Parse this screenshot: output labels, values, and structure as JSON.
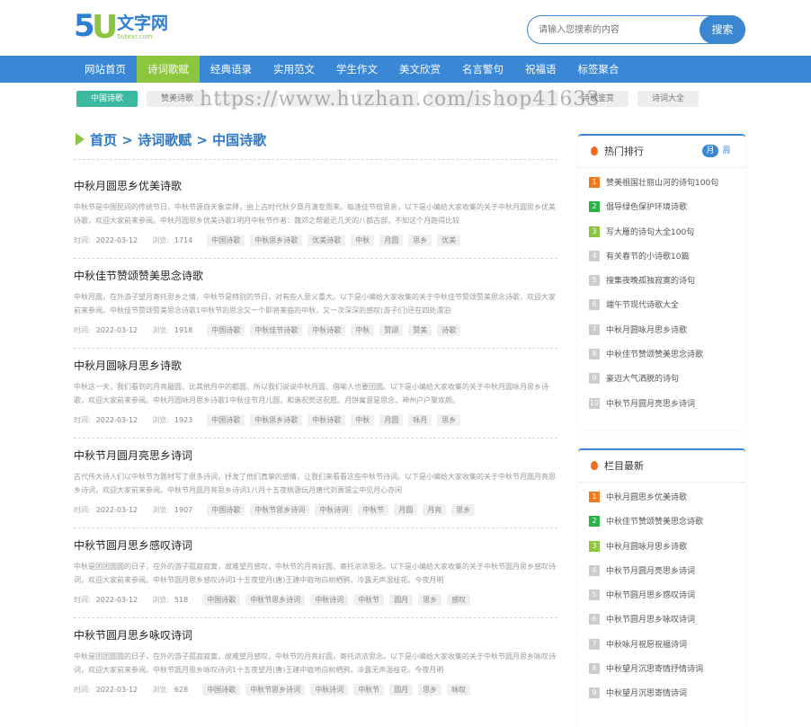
{
  "logo": {
    "five": "5",
    "u": "U",
    "cn": "文字网",
    "en": "5utexr.com"
  },
  "search": {
    "placeholder": "请输入您搜索的内容",
    "button": "搜索"
  },
  "nav": {
    "items": [
      "网站首页",
      "诗词歌赋",
      "经典语录",
      "实用范文",
      "学生作文",
      "美文欣赏",
      "名言警句",
      "祝福语",
      "标签聚合"
    ],
    "active": 1
  },
  "subnav": {
    "items": [
      "中国诗歌",
      "赞美诗歌",
      "",
      "",
      "",
      "",
      "",
      "诗歌鉴赏",
      "诗词大全"
    ]
  },
  "watermark": "https://www.huzhan.com/ishop41633",
  "breadcrumb": {
    "home": "首页",
    "sep": ">",
    "level1": "诗词歌赋",
    "level2": "中国诗歌"
  },
  "meta_labels": {
    "time": "时间:",
    "views": "浏览:"
  },
  "articles": [
    {
      "title": "中秋月圆思乡优美诗歌",
      "desc": "中秋节是中国民间的传统节日，中秋节源自天象崇拜，由上古时代秋夕祭月演变而来。每逢佳节倍思亲，以下是小编给大家收集的关于中秋月圆思乡优美诗歌，欢迎大家前来参阅。中秋月圆思乡优美诗歌1明月中秋节作者：魏邓之帮最近几天的八都古部，不知这个月跑得比较",
      "date": "2022-03-12",
      "views": "1714",
      "tags": [
        "中国诗歌",
        "中秋思乡诗歌",
        "优美诗歌",
        "中秋",
        "月圆",
        "思乡",
        "优美"
      ]
    },
    {
      "title": "中秋佳节赞颂赞美思念诗歌",
      "desc": "中秋月圆，在外游子望月寄托思乡之情。中秋节是特别的节日，对有些人意义重大。以下是小编给大家收集的关于中秋佳节赞颂赞美思念诗歌，欢迎大家前来参阅。中秋佳节赞颂赞美思念诗歌1中秋节的思念又一个即将来临的中秋，又一次深深的感叹(游子们)还在四处漂泊",
      "date": "2022-03-12",
      "views": "1918",
      "tags": [
        "中国诗歌",
        "中秋佳节诗歌",
        "中秋诗歌",
        "中秋",
        "赞颂",
        "赞美",
        "诗歌"
      ]
    },
    {
      "title": "中秋月圆咏月思乡诗歌",
      "desc": "中秋这一天，我们看到的月亮最圆，比其他月中的都圆，所以我们说说中秋月圆，借喻人也要团圆。以下是小编给大家收集的关于中秋月圆咏月思乡诗歌，欢迎大家前来参阅。中秋月圆咏月思乡诗歌1中秋佳节月儿圆，和谐祝贺送祝愿。月饼寓意是思念，神州户户聚欢颜。",
      "date": "2022-03-12",
      "views": "1923",
      "tags": [
        "中国诗歌",
        "中秋思乡诗歌",
        "中秋诗歌",
        "中秋",
        "月圆",
        "咏月",
        "思乡"
      ]
    },
    {
      "title": "中秋节月圆月亮思乡诗词",
      "desc": "古代伟大诗人们以中秋节为题材写了很多诗词，抒发了他们真挚的感情，让我们来看看这些中秋节诗词。以下是小编给大家收集的关于中秋节月圆月亮思乡诗词，欢迎大家前来参阅。中秋节月圆月亮思乡诗词1八月十五夜桃源玩月唐代刘禹锡尘中见月心亦闲",
      "date": "2022-03-12",
      "views": "1907",
      "tags": [
        "中国诗歌",
        "中秋节思乡诗词",
        "中秋诗词",
        "中秋节",
        "月圆",
        "月亮",
        "思乡"
      ]
    },
    {
      "title": "中秋节圆月思乡感叹诗词",
      "desc": "中秋是团团圆圆的日子，在外的游子孤寂寂寞，故难望月感叹，中秋节的月亮好圆，寄托浓浓思念。以下是小编给大家收集的关于中秋节圆月思乡感叹诗词，欢迎大家前来参阅。中秋节圆月思乡感叹诗词1十五夜望月(唐)王建中庭地白树栖鸦，冷露无声湿桂花。今夜月明",
      "date": "2022-03-12",
      "views": "518",
      "tags": [
        "中国诗歌",
        "中秋节思乡诗词",
        "中秋诗词",
        "中秋节",
        "圆月",
        "思乡",
        "感叹"
      ]
    },
    {
      "title": "中秋节圆月思乡咏叹诗词",
      "desc": "中秋是团团圆圆的日子，在外的游子孤寂寂寞，故难望月感叹，中秋节的月亮好圆，寄托浓浓思念。以下是小编给大家收集的关于中秋节圆月思乡咏叹诗词，欢迎大家前来参阅。中秋节圆月思乡咏叹诗词1十五夜望月(唐)王建中庭地白树栖鸦，冷露无声湿桂花。今夜月明",
      "date": "2022-03-12",
      "views": "628",
      "tags": [
        "中国诗歌",
        "中秋节思乡诗词",
        "中秋诗词",
        "中秋节",
        "圆月",
        "思乡",
        "咏叹"
      ]
    }
  ],
  "hot": {
    "title": "热门排行",
    "tab_month": "月",
    "tab_week": "周",
    "items": [
      "赞美祖国壮丽山河的诗句100句",
      "倡导绿色保护环境诗歌",
      "写大雁的诗句大全100句",
      "有关春节的小诗歌10篇",
      "搜集夜晚孤独寂寞的诗句",
      "端午节现代诗歌大全",
      "中秋月圆咏月思乡诗歌",
      "中秋佳节赞颂赞美思念诗歌",
      "豪迈大气洒脱的诗句",
      "中秋节月圆月亮思乡诗词"
    ]
  },
  "latest": {
    "title": "栏目最新",
    "items": [
      "中秋月圆思乡优美诗歌",
      "中秋佳节赞颂赞美思念诗歌",
      "中秋月圆咏月思乡诗歌",
      "中秋节月圆月亮思乡诗词",
      "中秋节圆月思乡感叹诗词",
      "中秋节圆月思乡咏叹诗词",
      "中秋咏月祝愿祝福诗词",
      "中秋望月沉思寄情抒情诗词",
      "中秋望月沉思寄情诗词"
    ]
  },
  "colors": {
    "primary": "#3a87d6",
    "accent": "#8cc63f",
    "subnav_active": "#3bb9a0"
  }
}
